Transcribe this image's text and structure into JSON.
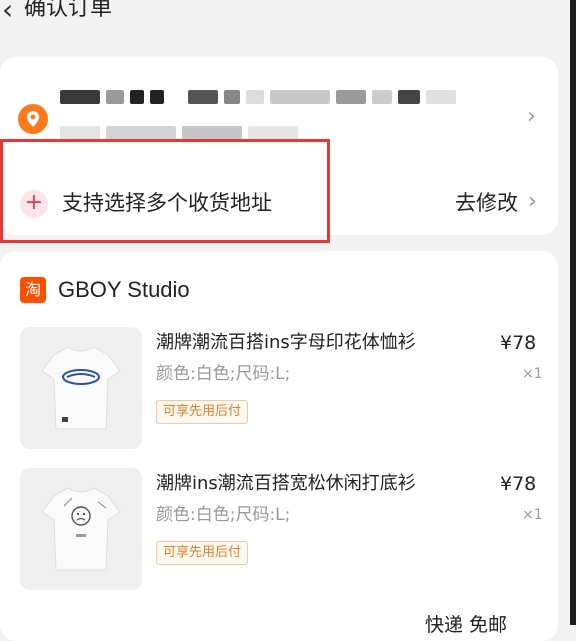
{
  "header": {
    "back_icon": "chevron-left-icon",
    "title": "确认订单"
  },
  "address": {
    "location_icon": "location-pin-icon",
    "multi_address_label": "支持选择多个收货地址",
    "modify_label": "去修改",
    "modify_chevron": "›",
    "row_chevron": "›",
    "accent_color": "#ff7a1a"
  },
  "shop": {
    "icon_glyph": "淘",
    "name": "GBOY Studio",
    "brand_color": "#ff5000"
  },
  "products": [
    {
      "title": "潮牌潮流百搭ins字母印花体恤衫",
      "price": "¥78",
      "spec": "颜色:白色;尺码:L;",
      "qty": "×1",
      "tag": "可享先用后付"
    },
    {
      "title": "潮牌ins潮流百搭宽松休闲打底衫",
      "price": "¥78",
      "spec": "颜色:白色;尺码:L;",
      "qty": "×1",
      "tag": "可享先用后付"
    }
  ],
  "shipping": {
    "label": "快递 免邮"
  }
}
